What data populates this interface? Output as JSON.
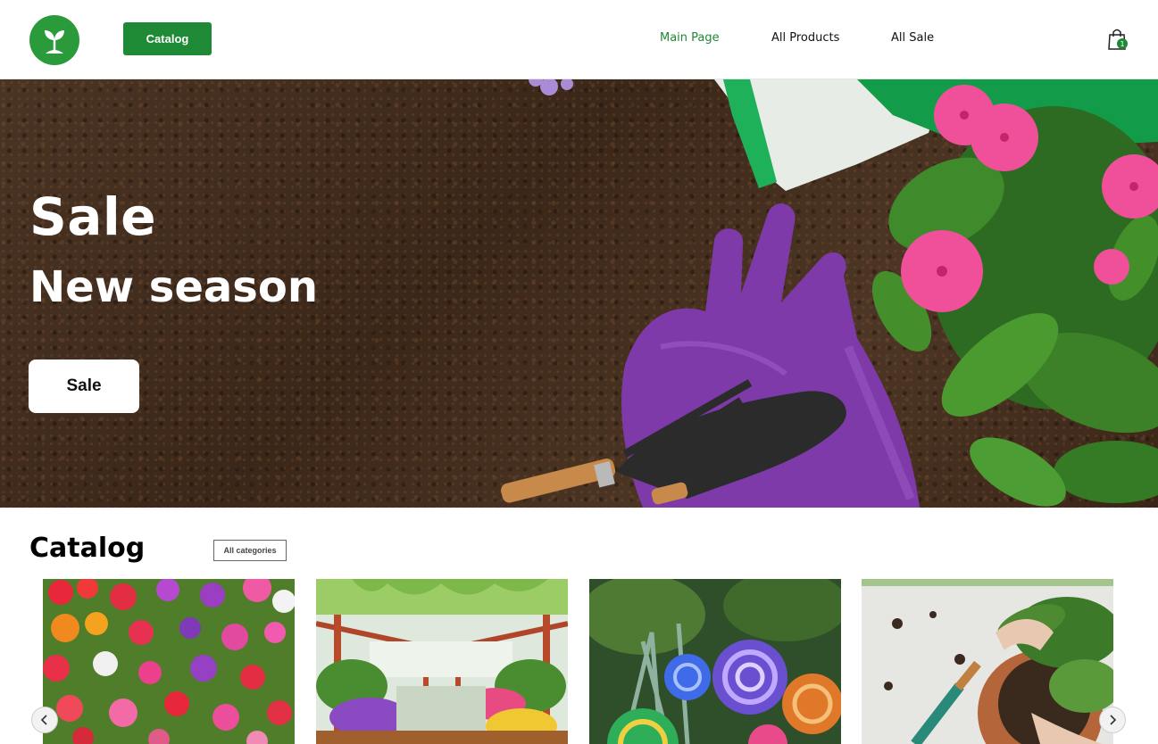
{
  "header": {
    "catalog_button": "Catalog",
    "nav": [
      {
        "label": "Main Page",
        "active": true
      },
      {
        "label": "All Products",
        "active": false
      },
      {
        "label": "All Sale",
        "active": false
      }
    ],
    "cart_count": "1"
  },
  "hero": {
    "title": "Sale",
    "subtitle": "New season",
    "button": "Sale"
  },
  "catalog": {
    "title": "Catalog",
    "all_categories_button": "All categories",
    "cards": [
      {
        "image": "flower-beds-photo"
      },
      {
        "image": "garden-center-photo"
      },
      {
        "image": "garden-decor-spirals-photo"
      },
      {
        "image": "potting-plant-photo"
      }
    ]
  },
  "colors": {
    "brand_green": "#1f8a36",
    "active_nav": "#1f8a36"
  },
  "icons": {
    "logo": "sprout-icon",
    "cart": "shopping-bag-icon",
    "prev": "chevron-left-icon",
    "next": "chevron-right-icon"
  }
}
